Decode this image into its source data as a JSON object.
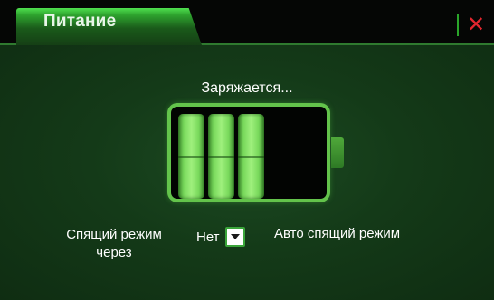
{
  "window": {
    "tab_title": "Питание",
    "close_icon": "close-icon",
    "close_glyph": "✕",
    "accent_color": "#3aa53a",
    "close_color": "#e3262f"
  },
  "battery": {
    "status_text": "Заряжается...",
    "charge_level_fraction": 0.6,
    "filled_cells": 3,
    "total_cells": 5,
    "icon": "battery-icon"
  },
  "settings": {
    "sleep_label": "Спящий режим через",
    "sleep_value": "Нет",
    "dropdown_icon": "chevron-down-icon",
    "auto_sleep_label": "Авто спящий режим"
  }
}
